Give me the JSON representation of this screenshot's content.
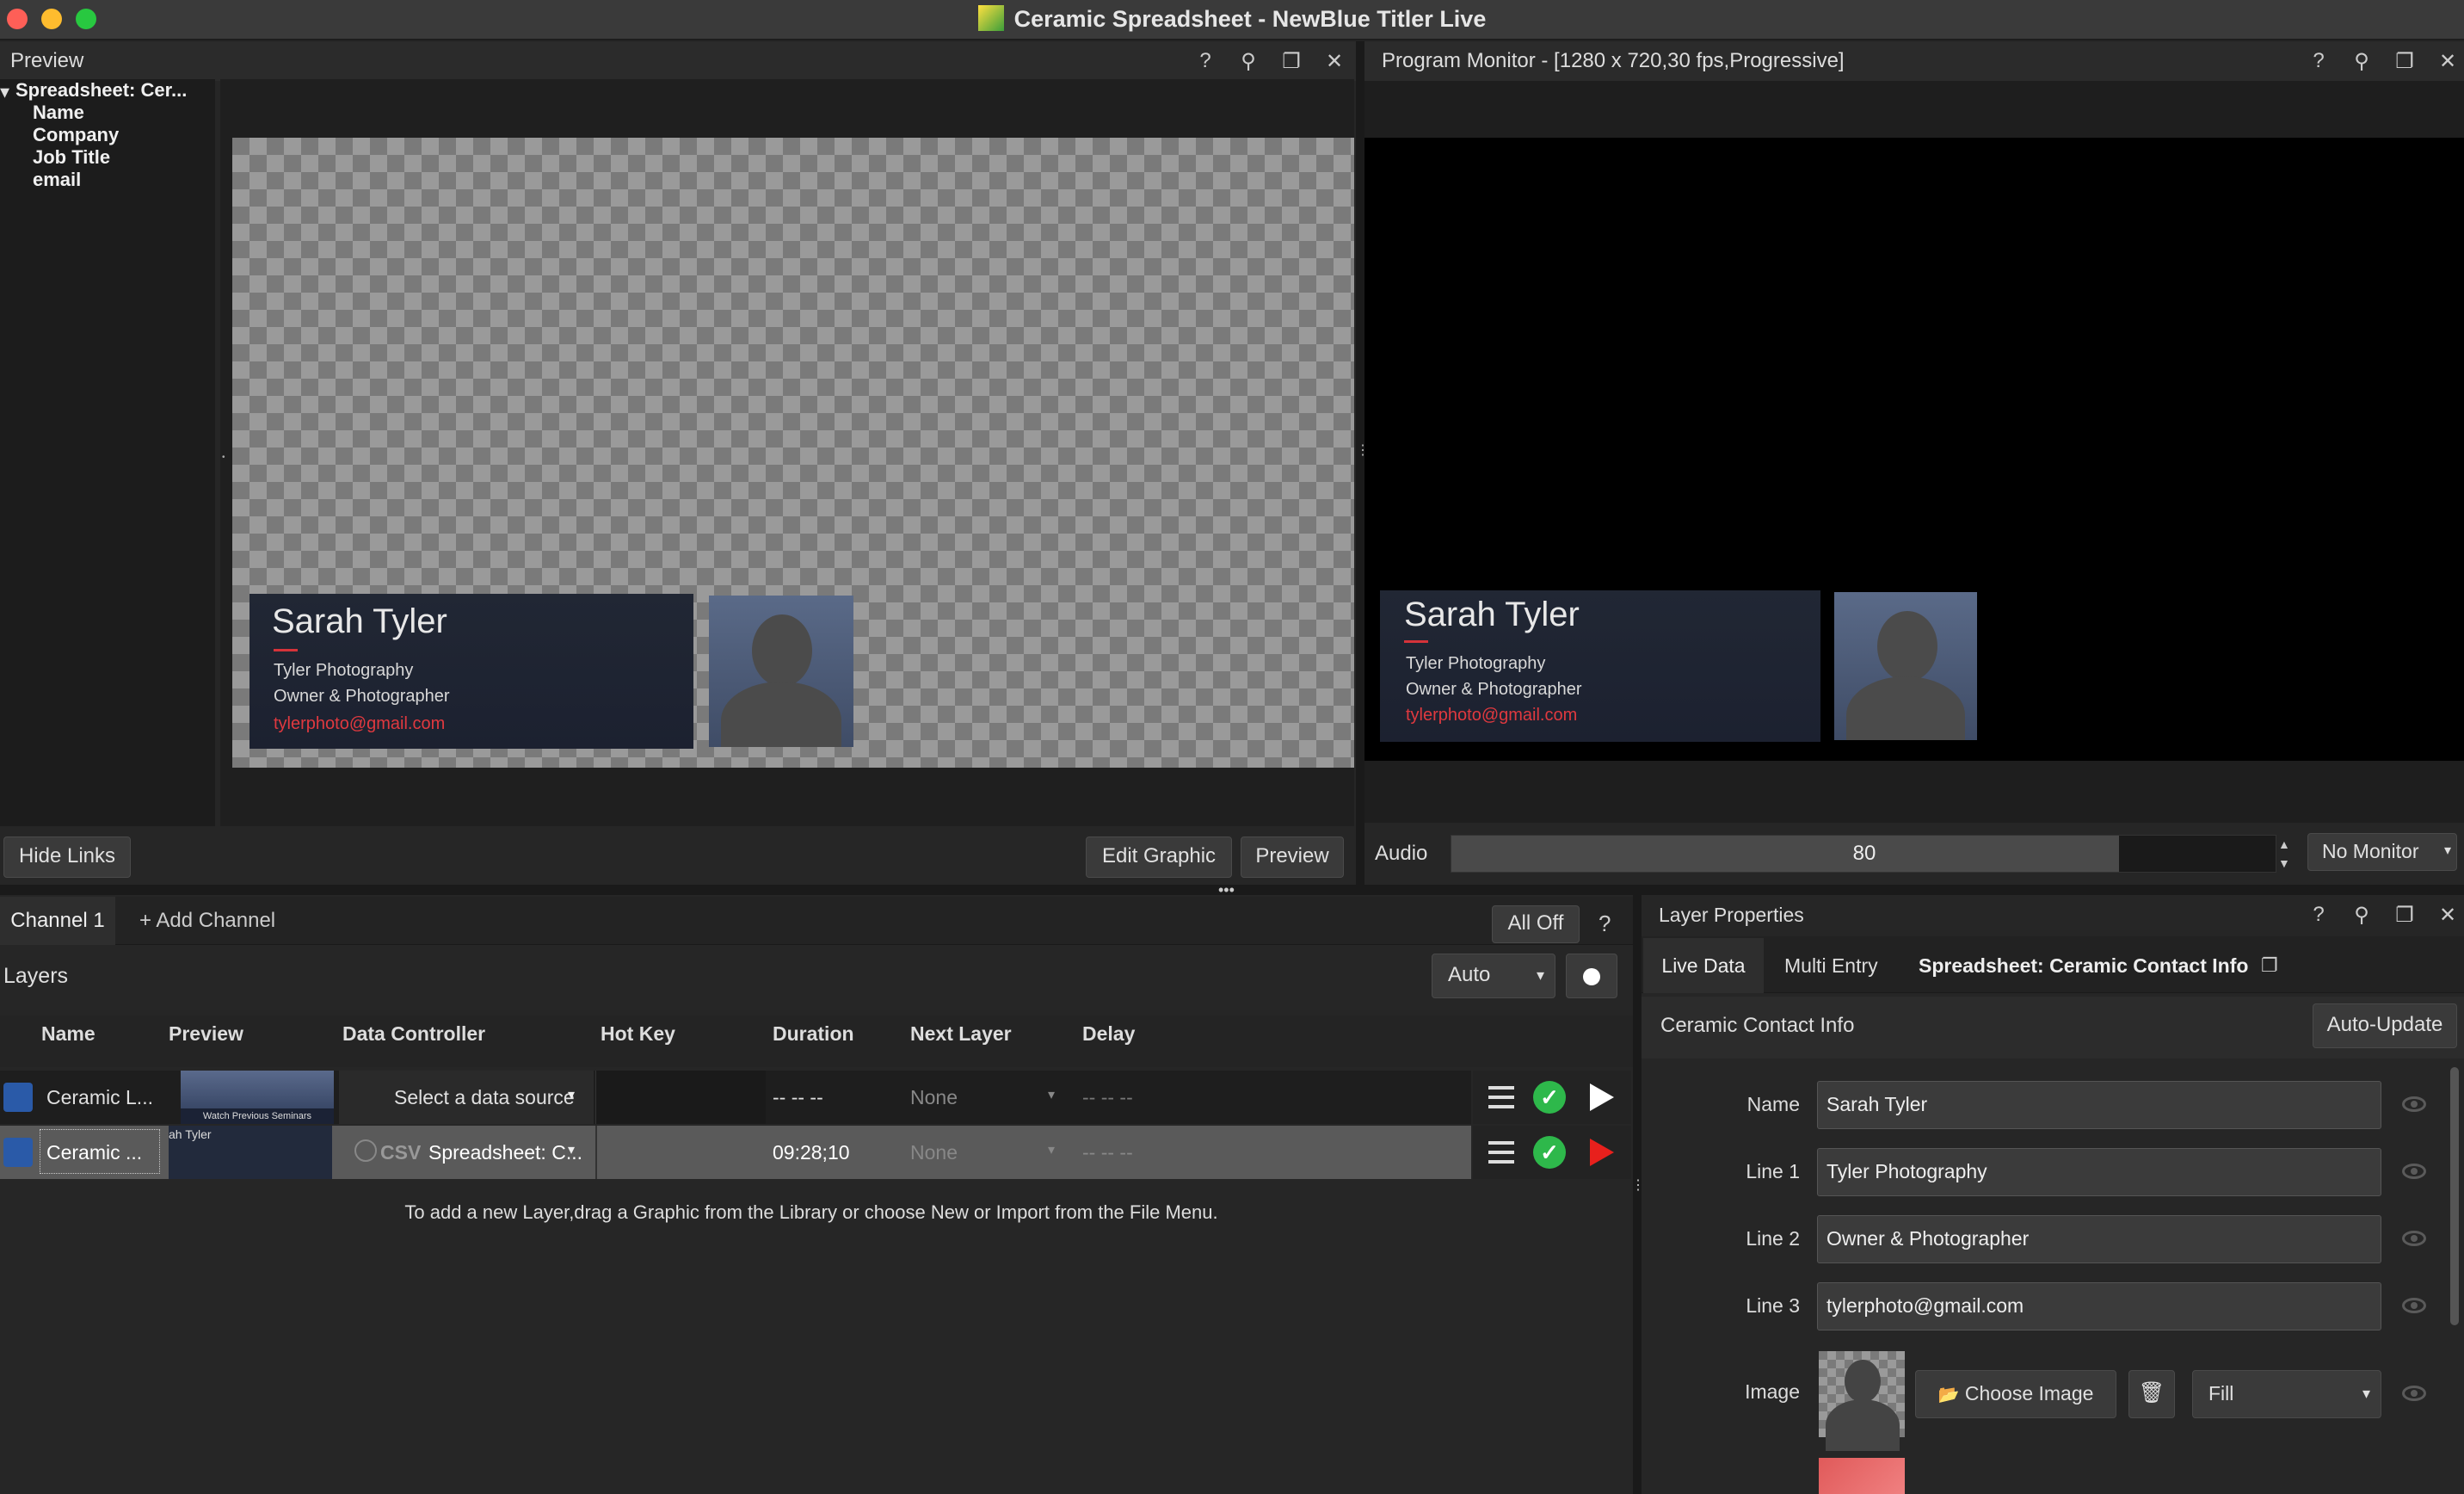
{
  "app": {
    "title": "Ceramic Spreadsheet - NewBlue Titler Live"
  },
  "preview": {
    "title": "Preview",
    "tree_root": "Spreadsheet: Cer...",
    "tree_items": [
      "Name",
      "Company",
      "Job Title",
      "email"
    ],
    "hide_links": "Hide Links",
    "edit_graphic": "Edit Graphic",
    "preview_btn": "Preview"
  },
  "graphic": {
    "name": "Sarah Tyler",
    "company": "Tyler Photography",
    "title": "Owner & Photographer",
    "email": "tylerphoto@gmail.com"
  },
  "program": {
    "title": "Program Monitor - [1280 x 720,30 fps,Progressive]",
    "audio_label": "Audio",
    "audio_value": "80",
    "audio_level": 0.81,
    "monitor_select": "No Monitor"
  },
  "channels": {
    "tab": "Channel 1",
    "add": "+ Add Channel",
    "all_off": "All Off",
    "help": "?"
  },
  "layers": {
    "title": "Layers",
    "mode": "Auto",
    "headers": {
      "name": "Name",
      "preview": "Preview",
      "controller": "Data Controller",
      "hotkey": "Hot Key",
      "duration": "Duration",
      "next": "Next Layer",
      "delay": "Delay"
    },
    "rows": [
      {
        "name": "Ceramic L...",
        "thumb_text": "Watch Previous Seminars",
        "controller": "Select a data source",
        "duration": "-- -- --",
        "next": "None",
        "delay": "-- -- --"
      },
      {
        "name": "Ceramic ...",
        "thumb_text": "ah Tyler",
        "controller_prefix": "CSV",
        "controller": "Spreadsheet: C...",
        "duration": "09:28;10",
        "next": "None",
        "delay": "-- -- --"
      }
    ],
    "hint": "To add a new Layer,drag a Graphic from the Library or choose New or Import from the File Menu."
  },
  "properties": {
    "title": "Layer Properties",
    "tabs": [
      "Live Data",
      "Multi Entry",
      "Spreadsheet: Ceramic Contact Info"
    ],
    "section": "Ceramic Contact Info",
    "auto_update": "Auto-Update",
    "fields": [
      {
        "label": "Name",
        "value": "Sarah Tyler"
      },
      {
        "label": "Line 1",
        "value": "Tyler Photography"
      },
      {
        "label": "Line 2",
        "value": "Owner & Photographer"
      },
      {
        "label": "Line 3",
        "value": "tylerphoto@gmail.com"
      }
    ],
    "image_label": "Image",
    "choose_image": "Choose Image",
    "fill_mode": "Fill"
  },
  "colors": {
    "accent_red": "#e0393f",
    "check_green": "#2eb84b",
    "play_red": "#e8201c"
  }
}
